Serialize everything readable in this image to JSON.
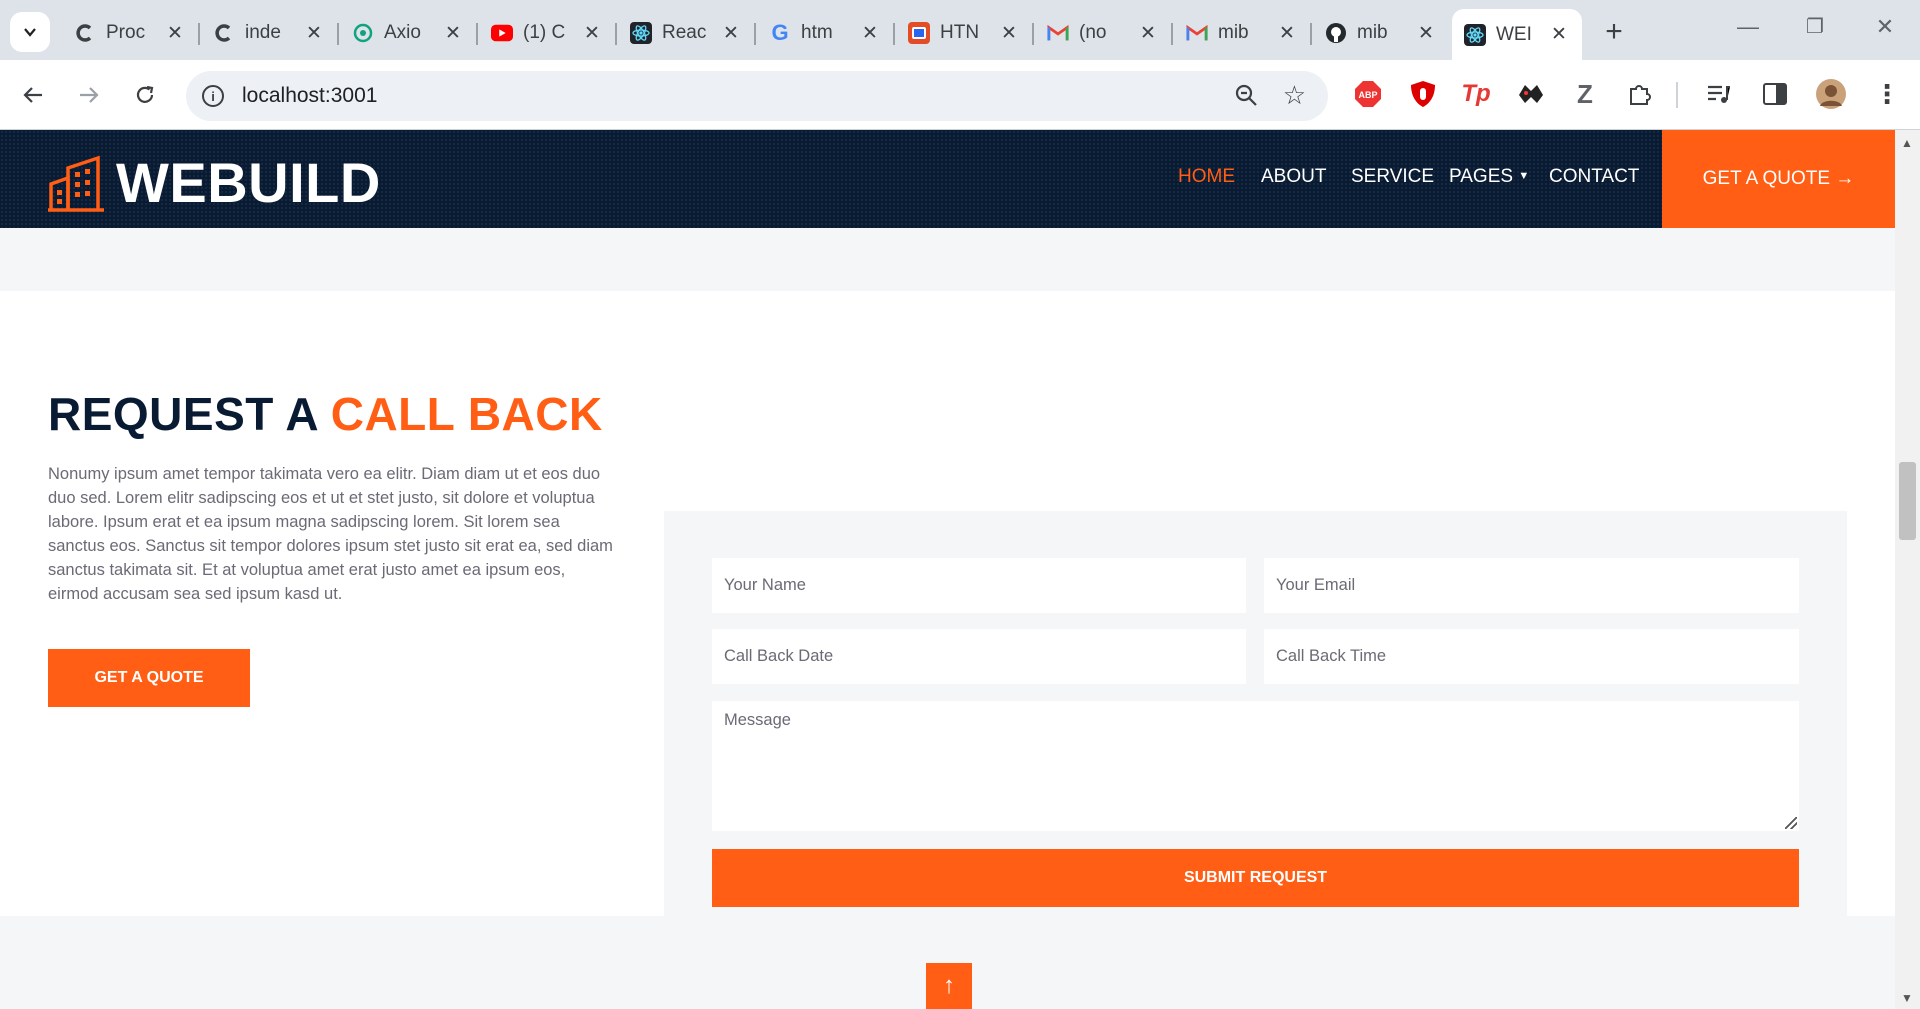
{
  "browser": {
    "tabs": [
      {
        "title": "Proc",
        "icon": "chrome-c-icon"
      },
      {
        "title": "inde",
        "icon": "chrome-c-icon"
      },
      {
        "title": "Axio",
        "icon": "openai-icon"
      },
      {
        "title": "(1) C",
        "icon": "youtube-icon"
      },
      {
        "title": "Reac",
        "icon": "react-icon"
      },
      {
        "title": "htm",
        "icon": "google-icon"
      },
      {
        "title": "HTN",
        "icon": "html-icon"
      },
      {
        "title": "(no",
        "icon": "gmail-icon"
      },
      {
        "title": "mib",
        "icon": "gmail-icon"
      },
      {
        "title": "mib",
        "icon": "github-icon"
      },
      {
        "title": "WEI",
        "icon": "react-icon"
      }
    ],
    "url": "localhost:3001",
    "extensions": [
      "adblock-icon",
      "ublock-icon",
      "tp-icon",
      "bat-icon",
      "z-icon",
      "puzzle-icon",
      "media-icon",
      "sidepanel-icon",
      "profile-avatar",
      "menu-icon"
    ]
  },
  "site": {
    "brand": "WEBUILD",
    "nav": {
      "home": "HOME",
      "about": "ABOUT",
      "service": "SERVICE",
      "pages": "PAGES",
      "contact": "CONTACT"
    },
    "quote_top": "GET A QUOTE →"
  },
  "callback": {
    "heading_part1": "REQUEST A",
    "heading_part2": "CALL BACK",
    "paragraph": "Nonumy ipsum amet tempor takimata vero ea elitr. Diam diam ut et eos duo duo sed. Lorem elitr sadipscing eos et ut et stet justo, sit dolore et voluptua labore. Ipsum erat et ea ipsum magna sadipscing lorem. Sit lorem sea sanctus eos. Sanctus sit tempor dolores ipsum stet justo sit erat ea, sed diam sanctus takimata sit. Et at voluptua amet erat justo amet ea ipsum eos, eirmod accusam sea sed ipsum kasd ut.",
    "cta": "GET A QUOTE",
    "form": {
      "name_placeholder": "Your Name",
      "email_placeholder": "Your Email",
      "date_placeholder": "Call Back Date",
      "time_placeholder": "Call Back Time",
      "message_placeholder": "Message",
      "submit": "SUBMIT REQUEST"
    }
  },
  "colors": {
    "accent": "#ff5e14",
    "navy": "#091a33",
    "light_bg": "#f4f6f8"
  }
}
